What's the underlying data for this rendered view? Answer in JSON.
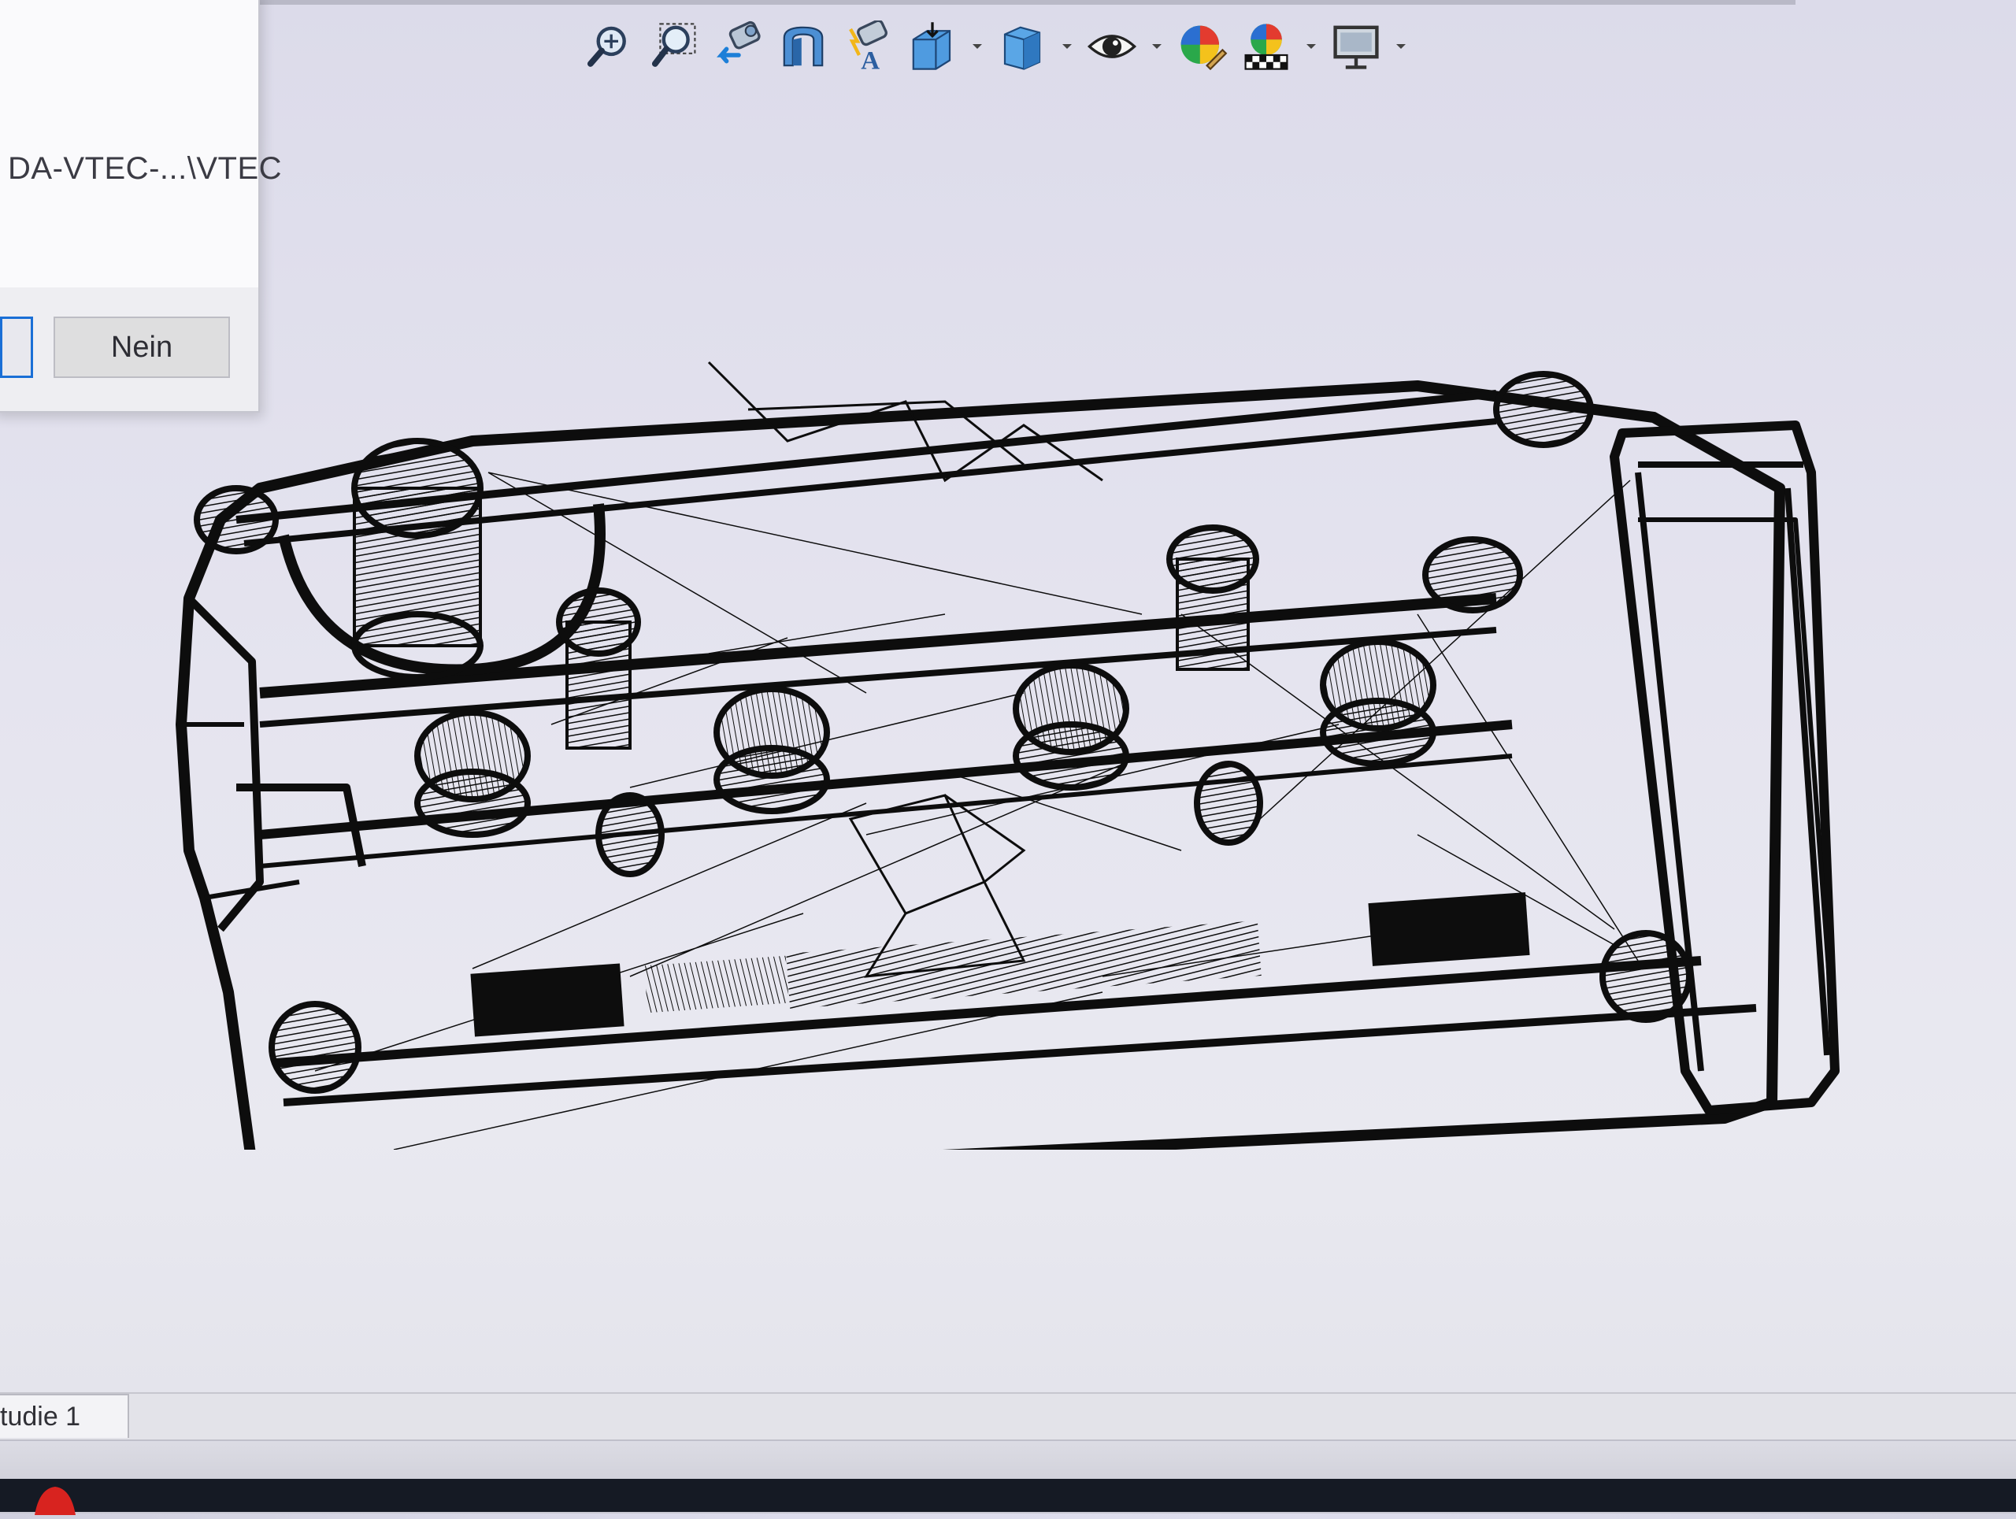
{
  "dialog": {
    "path_text": "DA-VTEC-...\\VTEC",
    "no_button_label": "Nein"
  },
  "toolbar": {
    "buttons": [
      {
        "icon": "zoom-to-fit-icon"
      },
      {
        "icon": "zoom-to-area-icon"
      },
      {
        "icon": "previous-view-icon"
      },
      {
        "icon": "section-view-icon"
      },
      {
        "icon": "dynamic-annotation-view-icon"
      },
      {
        "icon": "view-orientation-icon"
      },
      {
        "icon": "display-style-icon"
      },
      {
        "icon": "hide-show-items-icon"
      },
      {
        "icon": "edit-appearance-icon"
      },
      {
        "icon": "apply-scene-icon"
      },
      {
        "icon": "view-settings-icon"
      }
    ]
  },
  "tabs": {
    "study_label": "tudie 1"
  },
  "colors": {
    "wireframe": "#0d0d0d",
    "accent": "#1a6fd6"
  }
}
